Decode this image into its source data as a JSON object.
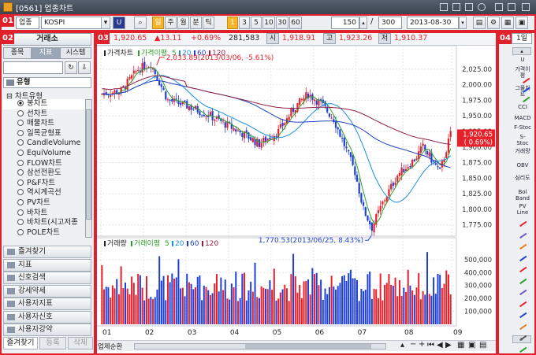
{
  "window": {
    "title": "[0561] 업종차트"
  },
  "toolbar": {
    "market": "업종",
    "index": "KOSPI",
    "periods": [
      "일",
      "주",
      "월",
      "분",
      "틱"
    ],
    "minutes": [
      "1",
      "3",
      "5",
      "10",
      "30",
      "60"
    ],
    "count": "150",
    "separator": "/",
    "total": "300",
    "date": "2013-08-30"
  },
  "badges": {
    "b1": "01",
    "b2": "02",
    "b3": "03",
    "b4": "04"
  },
  "left": {
    "header": "거래소",
    "tabs": [
      "종목",
      "지표",
      "시스템"
    ],
    "tree_root": "유형",
    "tree_group": "차트유형",
    "chart_types": [
      "봉차트",
      "선차트",
      "매물차트",
      "일목균형표",
      "CandleVolume",
      "EquiVolume",
      "FLOW차트",
      "삼선전환도",
      "P&F차트",
      "역시계곡선",
      "PV차트",
      "바차트",
      "바차트(시고저종",
      "POLE차트"
    ],
    "selected_index": 0,
    "folders": [
      "즐겨찾기",
      "지표",
      "신호검색",
      "강세약세",
      "사용자지표",
      "사용자신호",
      "사용자강약"
    ],
    "bottom_tabs": [
      "즐겨찾기",
      "등록",
      "삭제"
    ]
  },
  "quote": {
    "price": "1,920.65",
    "change": "▲13.11",
    "rate": "+0.69%",
    "volume": "281,583",
    "open_label": "시",
    "open": "1,918.91",
    "high_label": "고",
    "high": "1,923.26",
    "low_label": "저",
    "low": "1,910.37"
  },
  "price_legend": {
    "name": "가격차트",
    "ma": "가격이평",
    "p1": "5",
    "p2": "20",
    "p3": "60",
    "p4": "120"
  },
  "volume_legend": {
    "name": "거래량",
    "ma": "거래이평",
    "p1": "5",
    "p2": "20",
    "p3": "60",
    "p4": "120"
  },
  "annotations": {
    "high": "2,033.89(2013/03/06, -5.61%)",
    "low": "1,770.53(2013/06/25, 8.43%)"
  },
  "current_price_box": {
    "price": "1,920.65",
    "rate": "( 0.69%)"
  },
  "bottom": {
    "zoom_label": "업제순환"
  },
  "right_panel": {
    "period": "1일",
    "tools": [
      "U",
      "가격이평",
      "그물차트",
      "CCI",
      "MACD",
      "F-Stoc",
      "S-Stoc",
      "거래량",
      "OBV",
      "심리도",
      "Bol Band",
      "PV Line"
    ]
  },
  "colors": {
    "up": "#e8202a",
    "down": "#1e3fd8",
    "ma5": "#2aa02a",
    "ma20": "#1a8ee0",
    "ma60": "#2040c0",
    "ma120": "#902040"
  },
  "chart_data": {
    "type": "candlestick",
    "x_ticks": [
      "01",
      "02",
      "03",
      "04",
      "05",
      "06",
      "07",
      "08",
      "09"
    ],
    "price_ticks": [
      2025,
      2000,
      1975,
      1950,
      1925,
      1900,
      1875,
      1850,
      1825,
      1800,
      1775
    ],
    "price_range": [
      1762,
      2045
    ],
    "volume_ticks": [
      500000,
      400000,
      300000,
      200000,
      100000
    ],
    "volume_range": [
      0,
      560000
    ],
    "anchors": {
      "high": 2033.89,
      "low": 1770.53,
      "last": 1920.65
    }
  }
}
